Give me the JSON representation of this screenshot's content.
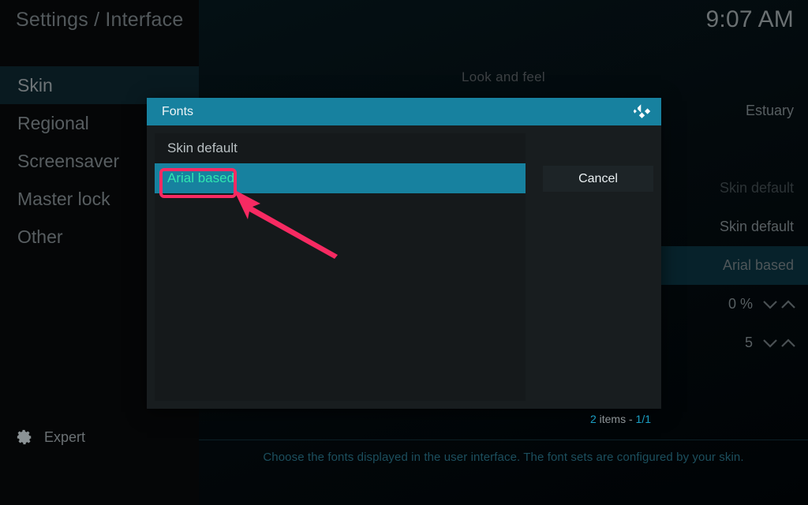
{
  "header": {
    "breadcrumb": "Settings / Interface",
    "clock": "9:07 AM"
  },
  "sidebar": {
    "items": [
      {
        "label": "Skin",
        "active": true
      },
      {
        "label": "Regional",
        "active": false
      },
      {
        "label": "Screensaver",
        "active": false
      },
      {
        "label": "Master lock",
        "active": false
      },
      {
        "label": "Other",
        "active": false
      }
    ],
    "footer": {
      "icon": "gear-icon",
      "label": "Expert"
    }
  },
  "main": {
    "category_title": "Look and feel",
    "setting_values": [
      {
        "value": "Estuary",
        "state": "normal",
        "spinner": false
      },
      {
        "value": "",
        "state": "normal",
        "spinner": false
      },
      {
        "value": "Skin default",
        "state": "dim",
        "spinner": false
      },
      {
        "value": "Skin default",
        "state": "normal",
        "spinner": false
      },
      {
        "value": "Arial based",
        "state": "highlighted",
        "spinner": false
      },
      {
        "value": "0 %",
        "state": "normal",
        "spinner": true
      },
      {
        "value": "5",
        "state": "normal",
        "spinner": true
      }
    ],
    "help_text": "Choose the fonts displayed in the user interface. The font sets are configured by your skin."
  },
  "dialog": {
    "title": "Fonts",
    "logo_icon": "kodi-logo-icon",
    "items": [
      {
        "label": "Skin default",
        "selected": false
      },
      {
        "label": "Arial based",
        "selected": true
      }
    ],
    "cancel_label": "Cancel",
    "count": {
      "total": "2",
      "items_label": "items -",
      "page": "1/1"
    }
  },
  "annotations": {
    "highlight_color": "#f72a62",
    "target": "Arial based"
  },
  "colors": {
    "accent_teal": "#17819f",
    "selected_text": "#2fe6b0",
    "annotation_pink": "#f72a62",
    "row_highlight": "#07222b"
  }
}
